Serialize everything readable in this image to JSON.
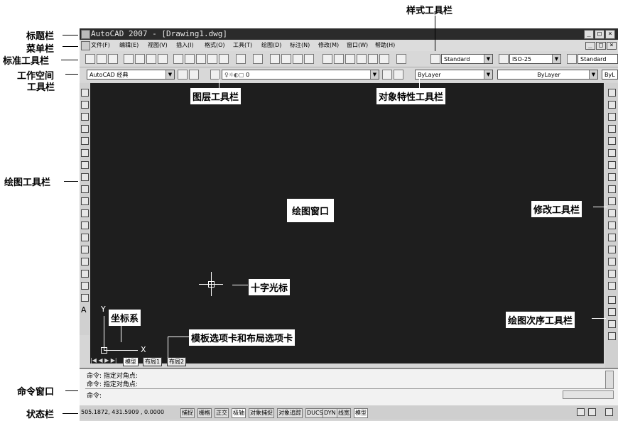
{
  "window": {
    "title": "AutoCAD 2007 - [Drawing1.dwg]",
    "controls": [
      "_",
      "□",
      "×"
    ],
    "doc_controls": [
      "_",
      "□",
      "×"
    ]
  },
  "menu": [
    "文件(F)",
    "编辑(E)",
    "视图(V)",
    "插入(I)",
    "格式(O)",
    "工具(T)",
    "绘图(D)",
    "标注(N)",
    "修改(M)",
    "窗口(W)",
    "帮助(H)"
  ],
  "styles": {
    "text_style": "Standard",
    "dim_style": "ISO-25",
    "table_style": "Standard"
  },
  "workspace": {
    "value": "AutoCAD 经典"
  },
  "layers": {
    "current": "0"
  },
  "properties": {
    "color": "ByLayer",
    "linetype": "ByLayer",
    "lineweight": "ByL"
  },
  "tabs": [
    "模型",
    "布局1",
    "布局2"
  ],
  "command": {
    "lines": [
      "命令: 指定对角点:",
      "命令: 指定对角点:"
    ],
    "prompt": "命令:"
  },
  "status": {
    "coords": "505.1872,  431.5909 , 0.0000",
    "buttons": [
      "捕捉",
      "栅格",
      "正交",
      "极轴",
      "对象捕捉",
      "对象追踪",
      "DUCS",
      "DYN",
      "线宽",
      "模型"
    ]
  },
  "ucs": {
    "x": "X",
    "y": "Y"
  },
  "annotations": {
    "title_bar": "标题栏",
    "menu_bar": "菜单栏",
    "standard_toolbar": "标准工具栏",
    "workspace_toolbar_1": "工作空间",
    "workspace_toolbar_2": "工具栏",
    "style_toolbar": "样式工具栏",
    "layer_toolbar": "图层工具栏",
    "properties_toolbar": "对象特性工具栏",
    "draw_toolbar": "绘图工具栏",
    "draw_window": "绘图窗口",
    "modify_toolbar": "修改工具栏",
    "crosshair": "十字光标",
    "ucs": "坐标系",
    "draw_order_toolbar": "绘图次序工具栏",
    "tabs": "模板选项卡和布局选项卡",
    "command_window": "命令窗口",
    "status_bar": "状态栏"
  }
}
